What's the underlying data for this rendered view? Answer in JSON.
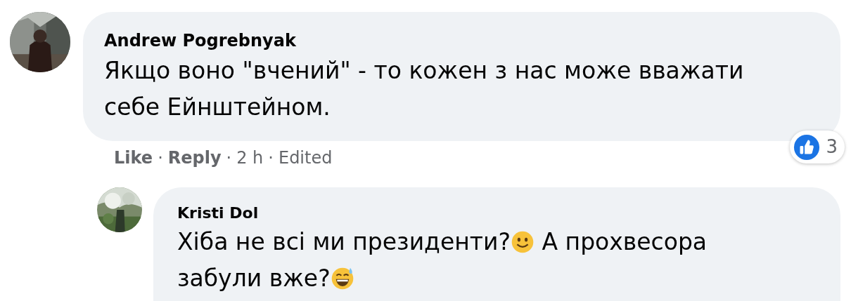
{
  "comments": [
    {
      "author": "Andrew Pogrebnyak",
      "body": [
        {
          "kind": "text",
          "text": "Якщо воно \"вчений\" - то кожен з нас може вважати себе Ейнштейном."
        }
      ],
      "separator": "·",
      "actions": [
        {
          "kind": "link",
          "text": "Like"
        },
        {
          "kind": "link",
          "text": "Reply"
        },
        {
          "kind": "meta",
          "text": "2 h"
        },
        {
          "kind": "meta",
          "text": "Edited"
        }
      ],
      "reactions": {
        "count": "3"
      },
      "replies": [
        {
          "author": "Kristi Dol",
          "body": [
            {
              "kind": "text",
              "text": "Хіба не всі ми президенти?"
            },
            {
              "kind": "smile"
            },
            {
              "kind": "text",
              "text": " А прохвесора забули вже?"
            },
            {
              "kind": "sweat-smile"
            }
          ]
        }
      ]
    }
  ]
}
